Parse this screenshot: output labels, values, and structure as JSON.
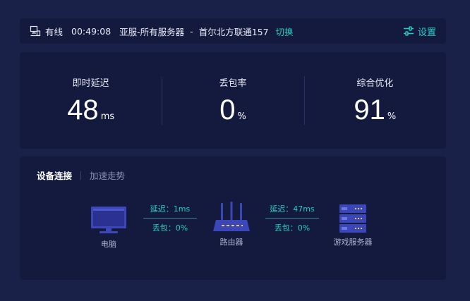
{
  "status_bar": {
    "connection": "有线",
    "time": "00:49:08",
    "region": "亚服-所有服务器",
    "separator": "-",
    "node": "首尔北方联通157",
    "switch_label": "切换",
    "settings_label": "设置"
  },
  "metrics": [
    {
      "label": "即时延迟",
      "value": "48",
      "unit": "ms"
    },
    {
      "label": "丢包率",
      "value": "0",
      "unit": "%"
    },
    {
      "label": "综合优化",
      "value": "91",
      "unit": "%"
    }
  ],
  "connection": {
    "tabs": [
      {
        "label": "设备连接",
        "active": true
      },
      {
        "label": "加速走势",
        "active": false
      }
    ],
    "devices": {
      "pc": "电脑",
      "router": "路由器",
      "server": "游戏服务器"
    },
    "links": [
      {
        "latency": "延迟：1ms",
        "loss": "丢包：0%"
      },
      {
        "latency": "延迟：47ms",
        "loss": "丢包：0%"
      }
    ]
  },
  "colors": {
    "background": "#1a2148",
    "panel": "#141a3e",
    "accent": "#1ecfc4",
    "device_blue": "#3b46b8"
  }
}
